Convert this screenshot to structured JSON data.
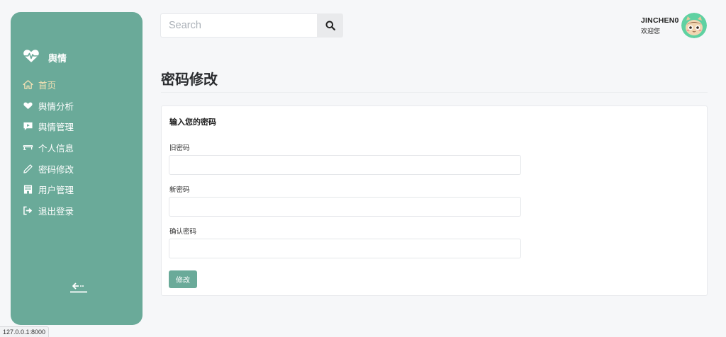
{
  "brand": {
    "name": "舆情",
    "icon": "heartbeat-icon"
  },
  "nav": [
    {
      "label": "首页",
      "icon": "home-icon",
      "active": true
    },
    {
      "label": "舆情分析",
      "icon": "heart-hand-icon",
      "active": false
    },
    {
      "label": "舆情管理",
      "icon": "video-comment-icon",
      "active": false
    },
    {
      "label": "个人信息",
      "icon": "id-card-icon",
      "active": false
    },
    {
      "label": "密码修改",
      "icon": "pencil-icon",
      "active": false
    },
    {
      "label": "用户管理",
      "icon": "building-icon",
      "active": false
    },
    {
      "label": "退出登录",
      "icon": "sign-out-icon",
      "active": false
    }
  ],
  "search": {
    "placeholder": "Search",
    "value": ""
  },
  "user": {
    "name": "JINCHEN0",
    "greeting": "欢迎您"
  },
  "page": {
    "title": "密码修改"
  },
  "form": {
    "title": "输入您的密码",
    "old_label": "旧密码",
    "new_label": "新密码",
    "confirm_label": "确认密码",
    "submit_label": "修改"
  },
  "status": {
    "url": "127.0.0.1:8000"
  },
  "colors": {
    "accent": "#6aaa99",
    "active_nav": "#f3e1b4",
    "background": "#f6f7f9"
  }
}
